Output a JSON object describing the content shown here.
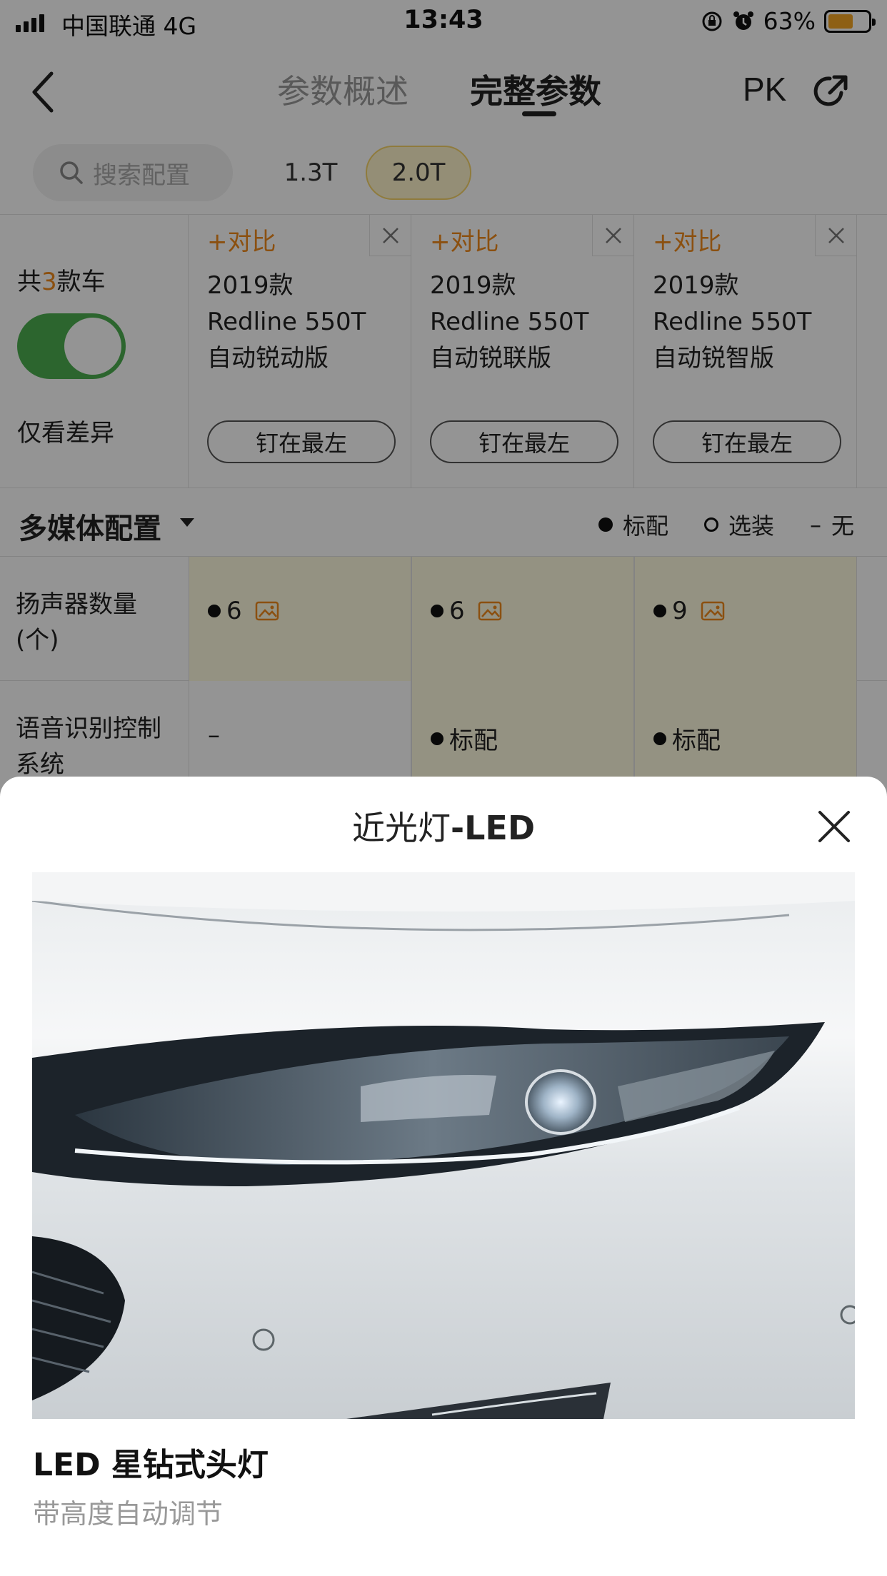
{
  "status_bar": {
    "carrier": "中国联通",
    "network": "4G",
    "time": "13:43",
    "battery_percent": "63%",
    "battery_level": 0.63
  },
  "nav": {
    "tabs": [
      "参数概述",
      "完整参数"
    ],
    "active_tab": "完整参数",
    "pk_label": "PK",
    "icons": [
      "back-arrow-icon",
      "share-icon"
    ]
  },
  "filter": {
    "search_placeholder": "搜索配置",
    "engine_chips": [
      "1.3T",
      "2.0T"
    ],
    "selected_chip": "2.0T"
  },
  "compare": {
    "count_prefix": "共",
    "count": "3",
    "count_suffix": "款车",
    "toggle_on": true,
    "diff_label": "仅看差异",
    "cars": [
      {
        "add_label": "+对比",
        "year": "2019款",
        "model": "Redline 550T",
        "trim": "自动锐动版",
        "pin_label": "钉在最左"
      },
      {
        "add_label": "+对比",
        "year": "2019款",
        "model": "Redline 550T",
        "trim": "自动锐联版",
        "pin_label": "钉在最左"
      },
      {
        "add_label": "+对比",
        "year": "2019款",
        "model": "Redline 550T",
        "trim": "自动锐智版",
        "pin_label": "钉在最左"
      }
    ]
  },
  "section": {
    "title": "多媒体配置",
    "legend": {
      "standard": "标配",
      "optional": "选装",
      "none_symbol": "–",
      "none": "无"
    }
  },
  "specs": [
    {
      "label_line1": "扬声器数量",
      "label_line2": "(个)",
      "values": [
        "6",
        "6",
        "9"
      ],
      "has_image": [
        true,
        true,
        true
      ]
    },
    {
      "label_line1": "语音识别控制",
      "label_line2": "系统",
      "values": [
        "–",
        "标配",
        "标配"
      ],
      "bullets": [
        false,
        true,
        true
      ]
    }
  ],
  "sheet": {
    "title_cn": "近光灯",
    "title_sep": "-",
    "title_en": "LED",
    "feature_name": "LED 星钻式头灯",
    "feature_desc": "带高度自动调节",
    "close_icon": "close-icon"
  },
  "colors": {
    "accent_orange": "#f08a1c",
    "toggle_green": "#4caf50",
    "highlight_yellow": "#fffbe0",
    "chip_yellow": "#fff5cc"
  }
}
